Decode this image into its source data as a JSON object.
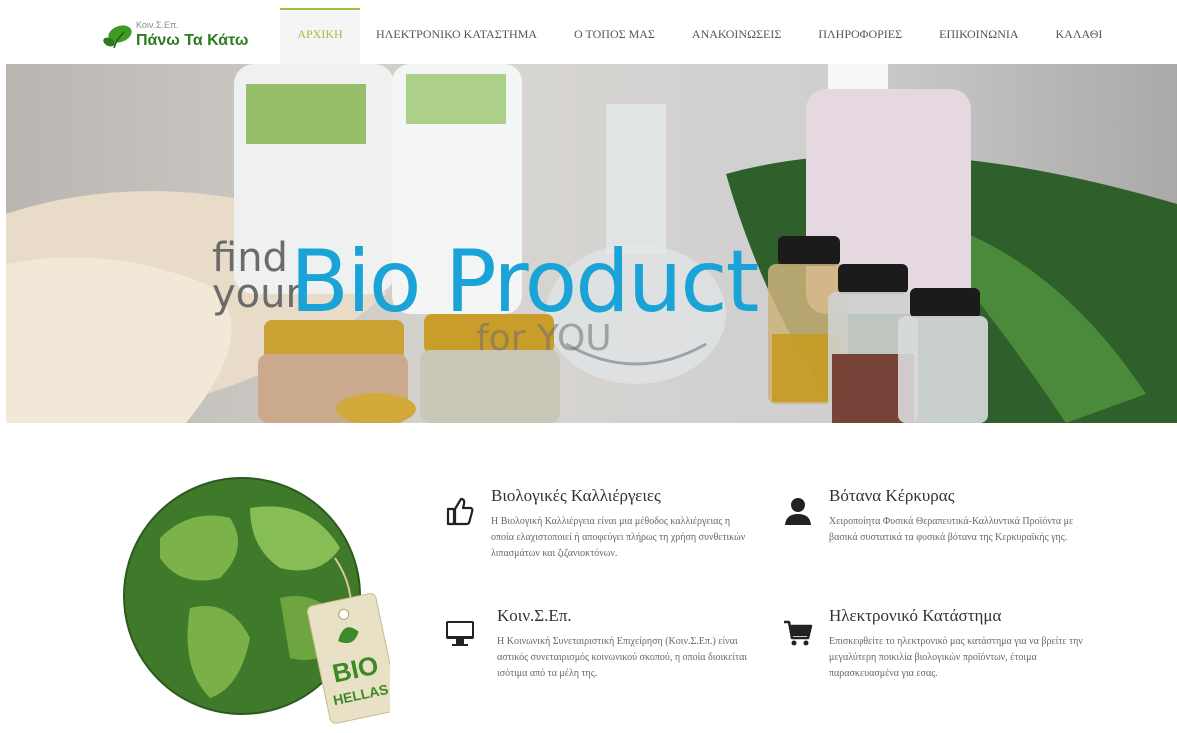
{
  "logo": {
    "small_text": "Κοιν.Σ.Επ.",
    "name": "Πάνω Τα Κάτω"
  },
  "nav": {
    "items": [
      {
        "label": "ΑΡΧΙΚΗ",
        "active": true
      },
      {
        "label": "ΗΛΕΚΤΡΟΝΙΚΟ ΚΑΤΑΣΤΗΜΑ",
        "active": false
      },
      {
        "label": "Ο ΤΟΠΟΣ ΜΑΣ",
        "active": false
      },
      {
        "label": "ΑΝΑΚΟΙΝΩΣΕΙΣ",
        "active": false
      },
      {
        "label": "ΠΛΗΡΟΦΟΡΙΕΣ",
        "active": false
      },
      {
        "label": "ΕΠΙΚΟΙΝΩΝΙΑ",
        "active": false
      },
      {
        "label": "ΚΑΛΑΘΙ",
        "active": false
      }
    ]
  },
  "hero": {
    "line1": "find",
    "line2": "your",
    "headline": "Bio Product",
    "subline": "for YOU"
  },
  "badge": {
    "line1": "BIO",
    "line2": "HELLAS"
  },
  "features": [
    {
      "icon": "thumbs-up-icon",
      "title": "Βιολογικές Καλλιέργειες",
      "text": "Η Βιολογική Καλλιέργεια είναι μια μέθοδος καλλιέργειας η οποία ελαχιστοποιεί ή αποφεύγει πλήρως τη χρήση συνθετικών λιπασμάτων και ζιζανιοκτόνων."
    },
    {
      "icon": "user-icon",
      "title": "Βότανα Κέρκυρας",
      "text": "Χειροποίητα Φυσικά Θεραπευτικά-Καλλυντικά Προϊόντα με βασικά συστατικά τα φυσικά βότανα της Κερκυραϊκής γης."
    },
    {
      "icon": "desktop-icon",
      "title": "Κοιν.Σ.Επ.",
      "text": "Η Κοινωνική Συνεταιριστική Επιχείρηση (Κοιν.Σ.Επ.) είναι αστικός συνεταιρισμός κοινωνικού σκοπού, η οποία διοικείται ισότιμα από τα μέλη της."
    },
    {
      "icon": "cart-icon",
      "title": "Ηλεκτρονικό Κατάστημα",
      "text": "Επισκεφθείτε το ηλεκτρονικό μας κατάστημα για να βρείτε την μεγαλύτερη ποικιλία βιολογικών προϊόντων, έτοιμα παρασκευασμένα για εσας."
    }
  ],
  "colors": {
    "accent": "#9ac23c",
    "logo_green": "#2d7a1f",
    "hero_blue": "#1aa3d6"
  }
}
